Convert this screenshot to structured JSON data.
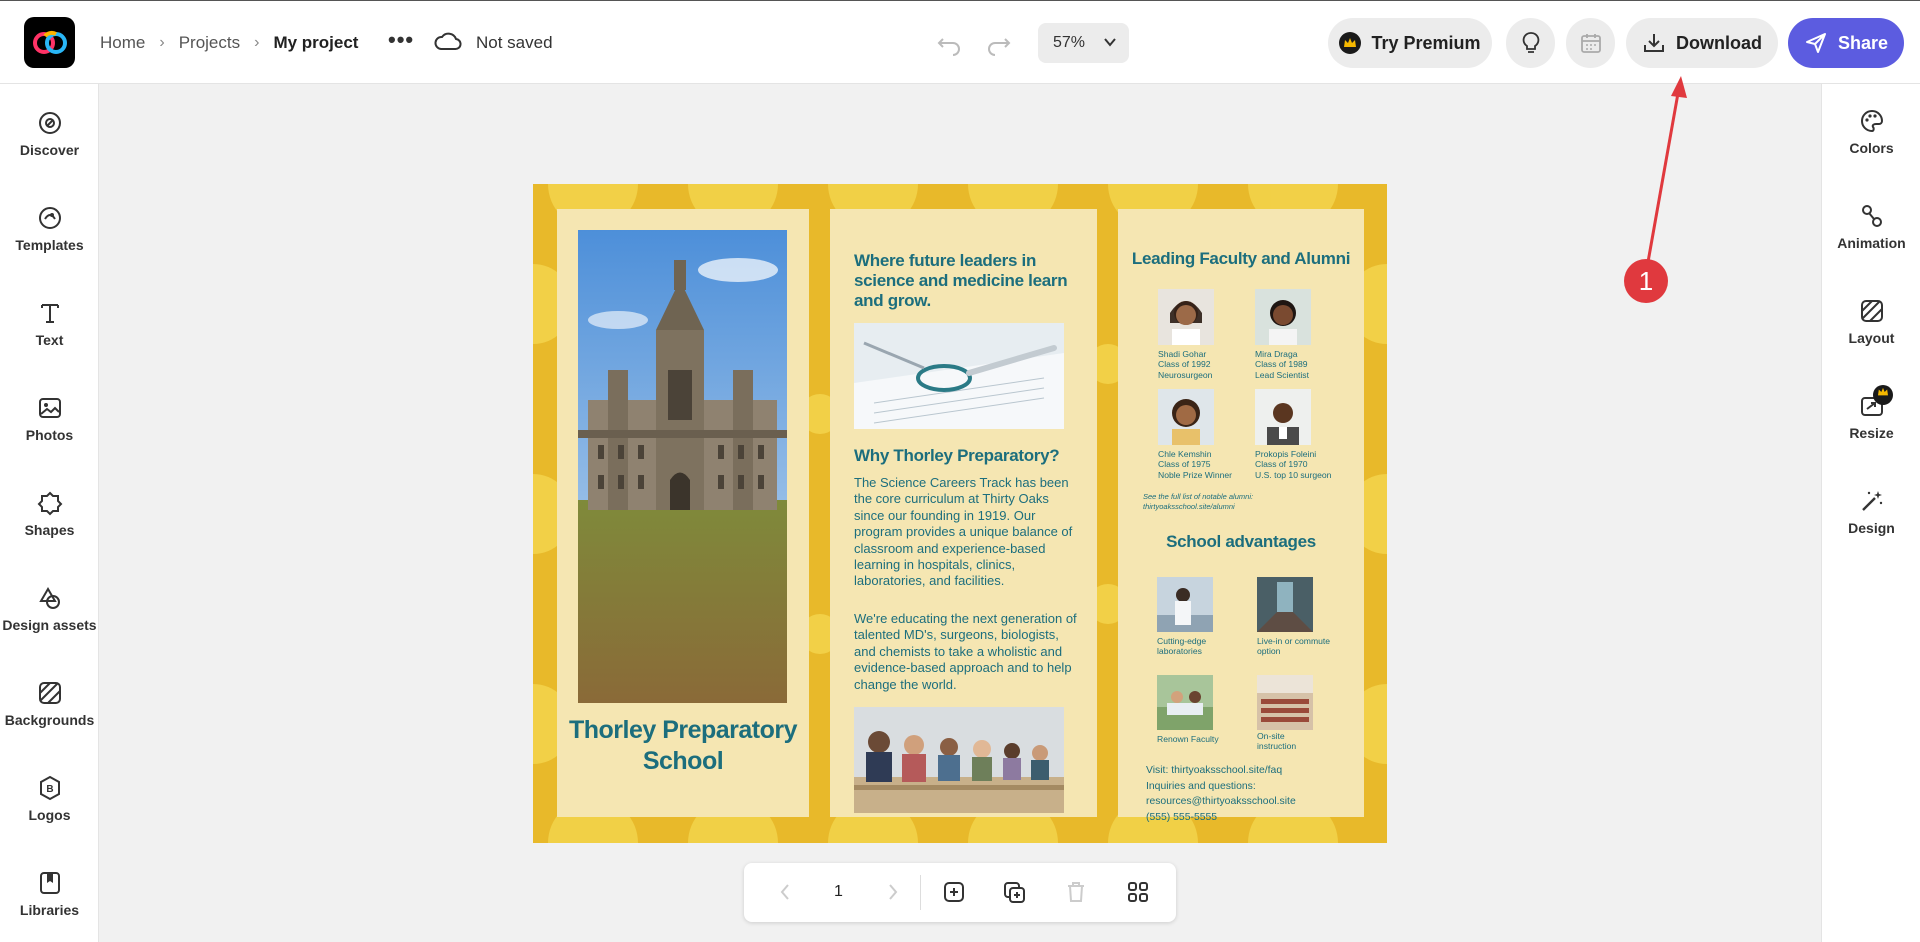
{
  "header": {
    "breadcrumbs": [
      "Home",
      "Projects",
      "My project"
    ],
    "save_status": "Not saved",
    "zoom": "57%",
    "try_premium": "Try Premium",
    "download": "Download",
    "share": "Share"
  },
  "left_nav": [
    {
      "label": "Discover",
      "icon": "compass-icon"
    },
    {
      "label": "Templates",
      "icon": "templates-icon"
    },
    {
      "label": "Text",
      "icon": "text-icon"
    },
    {
      "label": "Photos",
      "icon": "photo-icon"
    },
    {
      "label": "Shapes",
      "icon": "shapes-icon"
    },
    {
      "label": "Design assets",
      "icon": "design-assets-icon"
    },
    {
      "label": "Backgrounds",
      "icon": "backgrounds-icon"
    },
    {
      "label": "Logos",
      "icon": "logo-icon"
    },
    {
      "label": "Libraries",
      "icon": "libraries-icon"
    }
  ],
  "right_nav": [
    {
      "label": "Colors",
      "icon": "palette-icon"
    },
    {
      "label": "Animation",
      "icon": "animation-icon"
    },
    {
      "label": "Layout",
      "icon": "layout-icon"
    },
    {
      "label": "Resize",
      "icon": "resize-icon"
    },
    {
      "label": "Design",
      "icon": "magic-wand-icon"
    }
  ],
  "brochure": {
    "panel1": {
      "title": "Thorley Preparatory School"
    },
    "panel2": {
      "headline": "Where future leaders in science and medicine learn and grow.",
      "subhead": "Why Thorley Preparatory?",
      "body1": "The Science Careers Track has been the core curriculum at Thirty Oaks since our founding in 1919. Our program provides a unique balance of classroom and experience-based learning in hospitals, clinics, laboratories, and facilities.",
      "body2": "We're educating the next generation of talented MD's, surgeons, biologists, and chemists to take a wholistic and evidence-based approach and to help change the world."
    },
    "panel3": {
      "heading1": "Leading Faculty and Alumni",
      "people": [
        {
          "name": "Shadi Gohar",
          "class": "Class of 1992",
          "role": "Neurosurgeon"
        },
        {
          "name": "Mira Draga",
          "class": "Class of 1989",
          "role": "Lead Scientist"
        },
        {
          "name": "Chle Kemshin",
          "class": "Class of 1975",
          "role": "Noble Prize Winner"
        },
        {
          "name": "Prokopis Foleini",
          "class": "Class of 1970",
          "role": "U.S. top 10 surgeon"
        }
      ],
      "note": "See the full list of notable alumni: thirtyoaksschool.site/alumni",
      "heading2": "School advantages",
      "advantages": [
        "Cutting-edge laboratories",
        "Live-in or commute option",
        "Renown Faculty",
        "On-site instruction"
      ],
      "contact": [
        "Visit: thirtyoaksschool.site/faq",
        "Inquiries and questions:",
        "resources@thirtyoaksschool.site",
        "(555) 555-5555"
      ]
    }
  },
  "pager": {
    "page": "1"
  },
  "annotation": {
    "label": "1",
    "color": "#e0393e"
  },
  "colors": {
    "accent": "#5c5ce0",
    "brochure_text": "#1c6e7d",
    "brochure_bg": "#e8b92a"
  }
}
